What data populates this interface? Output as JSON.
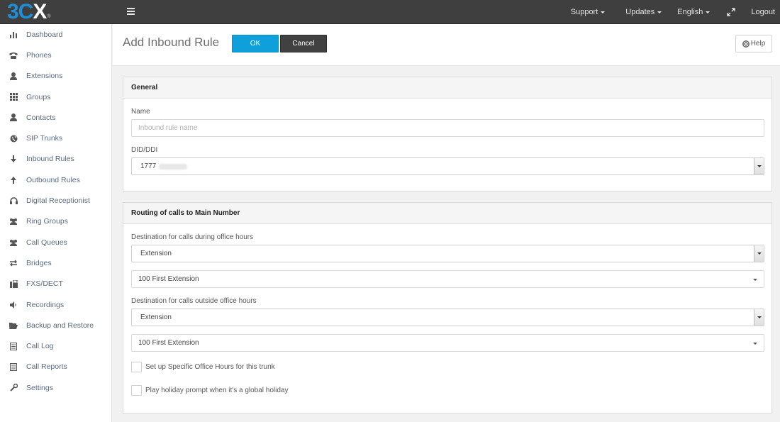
{
  "app": {
    "logo_main": "3C",
    "logo_x": "X",
    "logo_reg": "®"
  },
  "topnav": {
    "support": "Support",
    "updates": "Updates",
    "language": "English",
    "logout": "Logout"
  },
  "sidebar": {
    "items": [
      {
        "label": "Dashboard",
        "icon": "bar-chart-icon"
      },
      {
        "label": "Phones",
        "icon": "phone-icon"
      },
      {
        "label": "Extensions",
        "icon": "user-icon"
      },
      {
        "label": "Groups",
        "icon": "grid-icon"
      },
      {
        "label": "Contacts",
        "icon": "user-icon"
      },
      {
        "label": "SIP Trunks",
        "icon": "globe-icon"
      },
      {
        "label": "Inbound Rules",
        "icon": "arrow-down-icon"
      },
      {
        "label": "Outbound Rules",
        "icon": "arrow-up-icon"
      },
      {
        "label": "Digital Receptionist",
        "icon": "headset-icon"
      },
      {
        "label": "Ring Groups",
        "icon": "users-icon"
      },
      {
        "label": "Call Queues",
        "icon": "users-icon"
      },
      {
        "label": "Bridges",
        "icon": "exchange-icon"
      },
      {
        "label": "FXS/DECT",
        "icon": "fax-icon"
      },
      {
        "label": "Recordings",
        "icon": "volume-icon"
      },
      {
        "label": "Backup and Restore",
        "icon": "folder-open-icon"
      },
      {
        "label": "Call Log",
        "icon": "list-icon"
      },
      {
        "label": "Call Reports",
        "icon": "list-icon"
      },
      {
        "label": "Settings",
        "icon": "wrench-icon"
      }
    ]
  },
  "header": {
    "title": "Add Inbound Rule",
    "ok_label": "OK",
    "cancel_label": "Cancel",
    "help_label": "Help"
  },
  "general": {
    "heading": "General",
    "name_label": "Name",
    "name_placeholder": "Inbound rule name",
    "did_label": "DID/DDI",
    "did_value": "1777"
  },
  "routing": {
    "heading": "Routing of calls to Main Number",
    "office_label": "Destination for calls during office hours",
    "office_type": "Extension",
    "office_target": "100 First Extension",
    "outside_label": "Destination for calls outside office hours",
    "outside_type": "Extension",
    "outside_target": "100 First Extension",
    "check1_label": "Set up Specific Office Hours for this trunk",
    "check1_checked": false,
    "check2_label": "Play holiday prompt when it's a global holiday",
    "check2_checked": false
  },
  "colors": {
    "accent": "#0fa0dc",
    "topbar": "#3f3f3f",
    "sidebar_text": "#5a6a7e"
  }
}
